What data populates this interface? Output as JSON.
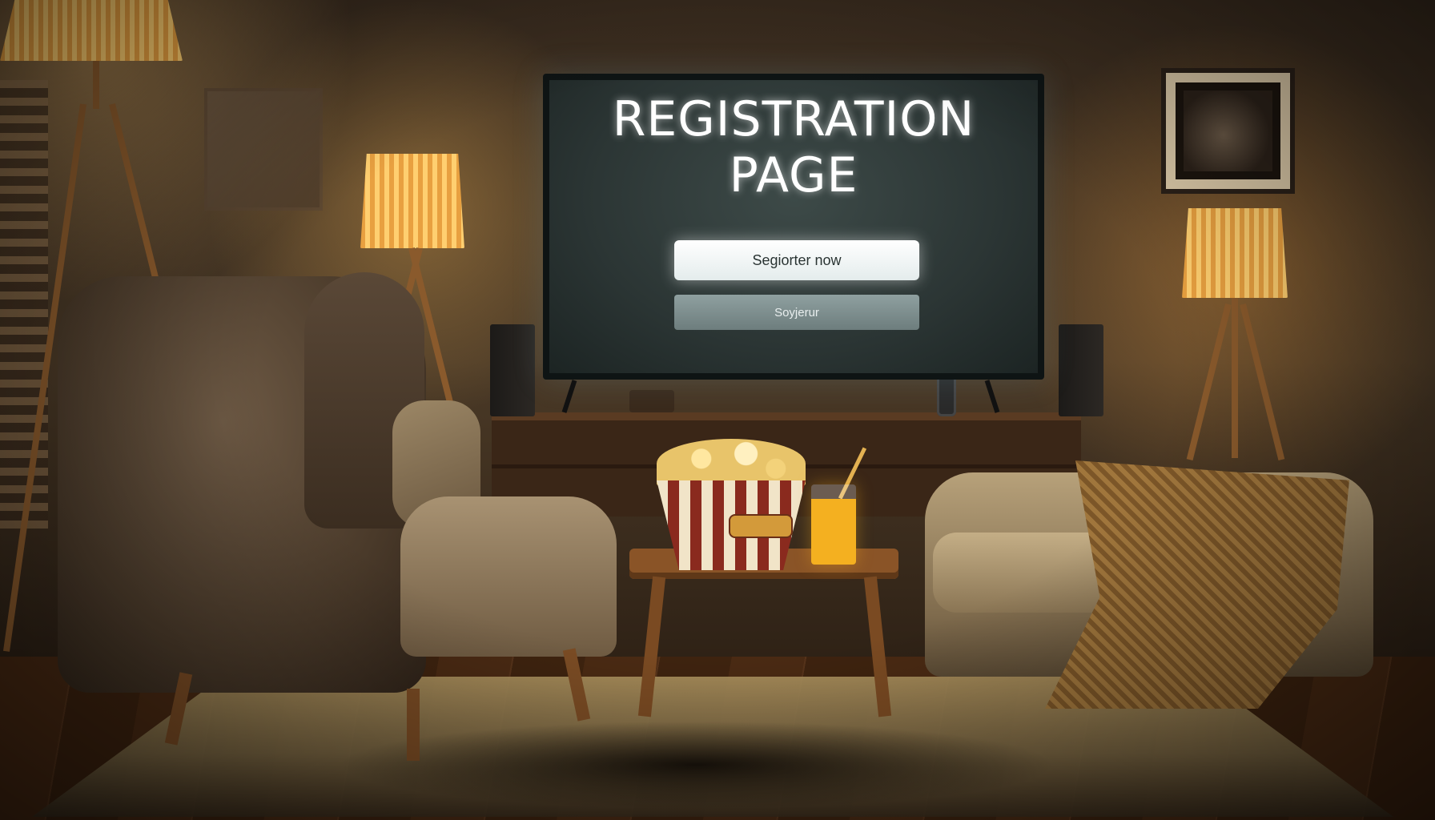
{
  "tv_screen": {
    "title": "REGISTRATION PAGE",
    "primary_button_label": "Segiorter now",
    "secondary_button_label": "Soyjerur"
  },
  "colors": {
    "screen_background": "#2b3534",
    "primary_button": "#ffffff",
    "secondary_button": "#7c8c8c",
    "lamp_glow": "#ffb85a"
  },
  "icons": [
    "floor-lamp-icon",
    "table-lamp-icon",
    "remote-icon",
    "popcorn-bowl-icon",
    "juice-glass-icon"
  ]
}
